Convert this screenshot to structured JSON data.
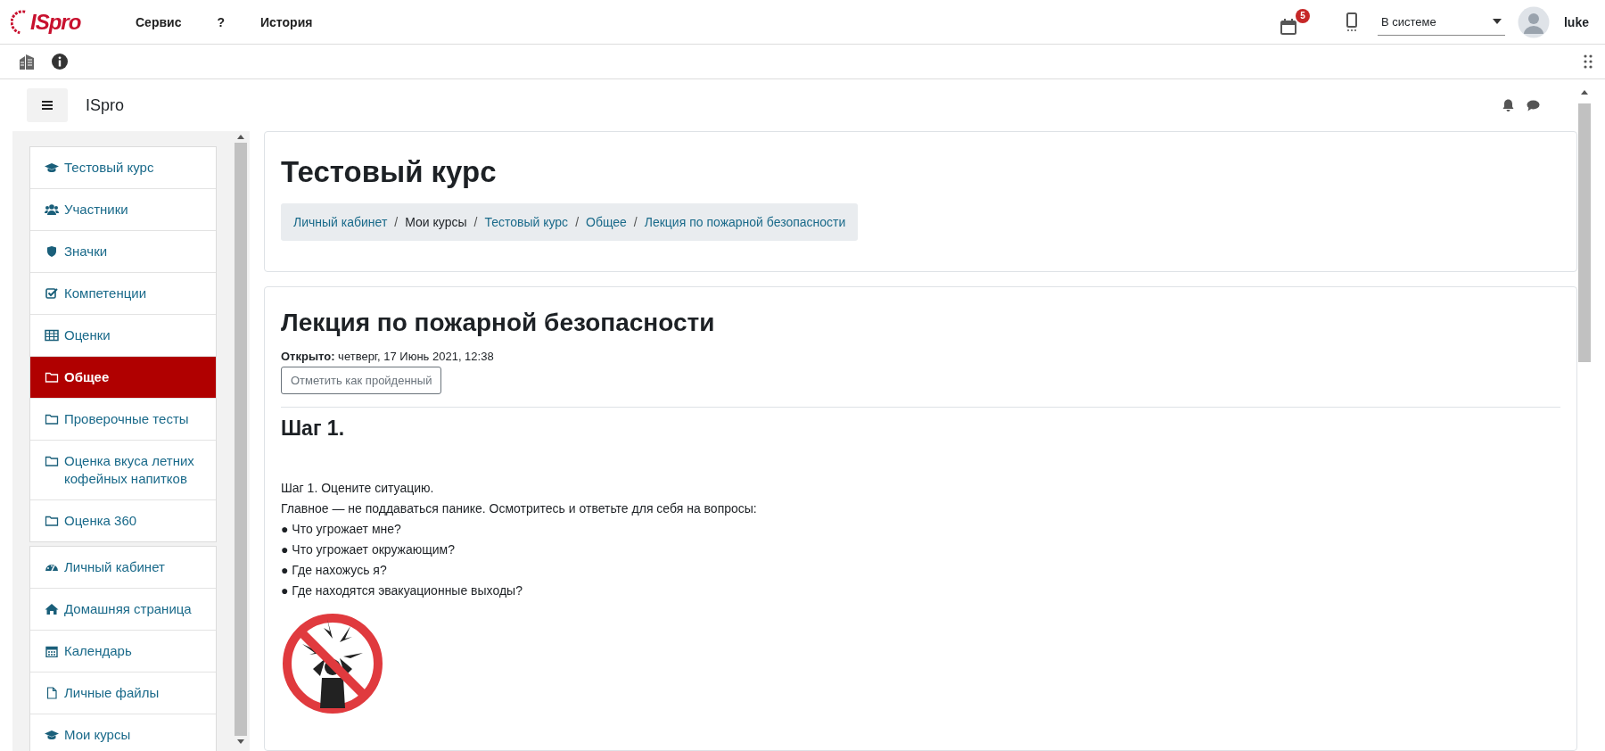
{
  "header": {
    "logo": "ISpro",
    "menu": [
      {
        "label": "Сервис"
      },
      {
        "label": "?"
      },
      {
        "label": "История"
      }
    ],
    "calendar_badge": "5",
    "status_select": {
      "value": "В системе"
    },
    "user": "luke"
  },
  "site_bar": {
    "title": "ISpro"
  },
  "sidebar": {
    "groups": [
      [
        {
          "kind": "course",
          "label": "Тестовый курс",
          "selected": false
        },
        {
          "kind": "participants",
          "label": "Участники",
          "selected": false
        },
        {
          "kind": "badges",
          "label": "Значки",
          "selected": false
        },
        {
          "kind": "competencies",
          "label": "Компетенции",
          "selected": false
        },
        {
          "kind": "grades",
          "label": "Оценки",
          "selected": false
        },
        {
          "kind": "section",
          "label": "Общее",
          "selected": true
        },
        {
          "kind": "section",
          "label": "Проверочные тесты",
          "selected": false
        },
        {
          "kind": "section",
          "label": "Оценка вкуса летних кофейных напитков",
          "selected": false
        },
        {
          "kind": "section",
          "label": "Оценка 360",
          "selected": false
        }
      ],
      [
        {
          "kind": "dashboard",
          "label": "Личный кабинет",
          "selected": false
        },
        {
          "kind": "home",
          "label": "Домашняя страница",
          "selected": false
        },
        {
          "kind": "calendar",
          "label": "Календарь",
          "selected": false
        },
        {
          "kind": "files",
          "label": "Личные файлы",
          "selected": false
        },
        {
          "kind": "course",
          "label": "Мои курсы",
          "selected": false
        }
      ]
    ]
  },
  "course_card": {
    "title": "Тестовый курс",
    "breadcrumbs": [
      {
        "label": "Личный кабинет",
        "link": true
      },
      {
        "label": "Мои курсы",
        "link": false
      },
      {
        "label": "Тестовый курс",
        "link": true
      },
      {
        "label": "Общее",
        "link": true
      },
      {
        "label": "Лекция по пожарной безопасности",
        "link": true
      }
    ],
    "separator": "/"
  },
  "page": {
    "title": "Лекция по пожарной безопасности",
    "opened_label": "Открыто:",
    "opened_value": "четверг, 17 Июнь 2021, 12:38",
    "complete_button": "Отметить как пройденный",
    "section_title": "Шаг 1.",
    "lines": [
      "Шаг 1. Оцените ситуацию.",
      "Главное — не поддаваться панике. Осмотритесь и ответьте для себя на вопросы:",
      "● Что угрожает мне?",
      "● Что угрожает окружающим?",
      "● Где нахожусь я?",
      "● Где находятся эвакуационные выходы?"
    ]
  }
}
